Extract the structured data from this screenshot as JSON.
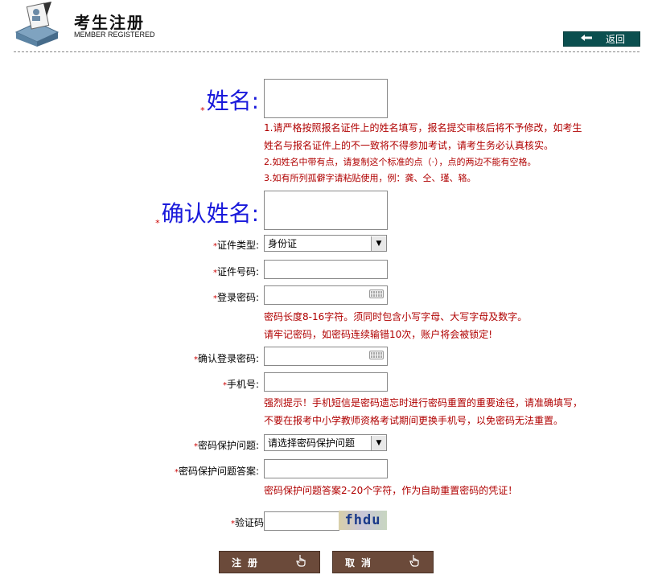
{
  "header": {
    "title": "考生注册",
    "subtitle": "MEMBER REGISTERED",
    "back_label": "返回"
  },
  "form": {
    "name_label": "姓名:",
    "name_hints": [
      "1.请严格按照报名证件上的姓名填写，报名提交审核后将不予修改，如考生",
      "姓名与报名证件上的不一致将不得参加考试，请考生务必认真核实。",
      "2.如姓名中带有点，请复制这个标准的点（·），点的两边不能有空格。",
      "3.如有所列孤僻字请粘贴使用，例：龚、仝、瑾、辂。"
    ],
    "confirm_name_label": "确认姓名:",
    "id_type_label": "证件类型:",
    "id_type_value": "身份证",
    "id_number_label": "证件号码:",
    "password_label": "登录密码:",
    "password_hints": [
      "密码长度8-16字符。须同时包含小写字母、大写字母及数字。",
      "请牢记密码，如密码连续输错10次，账户将会被锁定!"
    ],
    "confirm_password_label": "确认登录密码:",
    "phone_label": "手机号:",
    "phone_hints": [
      "强烈提示！手机短信是密码遗忘时进行密码重置的重要途径，请准确填写，",
      "不要在报考中小学教师资格考试期间更换手机号，以免密码无法重置。"
    ],
    "security_question_label": "密码保护问题:",
    "security_question_value": "请选择密码保护问题",
    "security_answer_label": "密码保护问题答案:",
    "security_answer_hint": "密码保护问题答案2-20个字符，作为自助重置密码的凭证！",
    "captcha_label": "验证码",
    "captcha_text": "fhdu",
    "star": "*"
  },
  "buttons": {
    "register": "注册",
    "cancel": "取消"
  },
  "colors": {
    "accent": "#0b4f4f",
    "hint": "#b00000",
    "big_label": "#1a1adb",
    "button": "#6b4a3a"
  }
}
